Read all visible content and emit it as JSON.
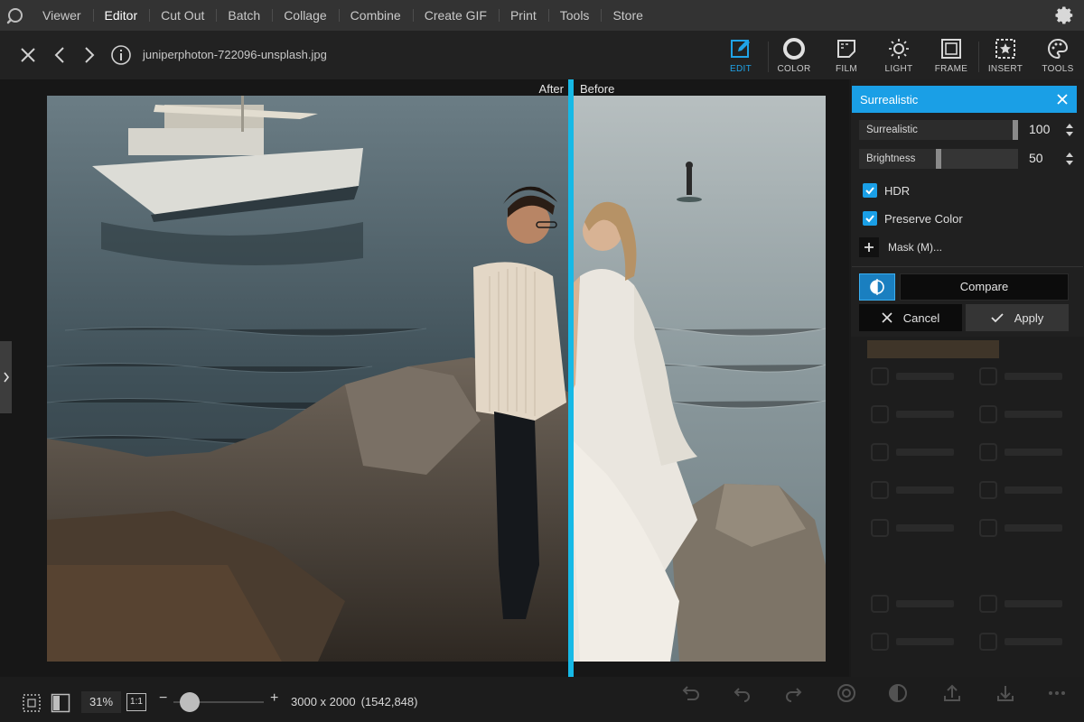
{
  "menu": {
    "items": [
      {
        "label": "Viewer"
      },
      {
        "label": "Editor"
      },
      {
        "label": "Cut Out"
      },
      {
        "label": "Batch"
      },
      {
        "label": "Collage"
      },
      {
        "label": "Combine"
      },
      {
        "label": "Create GIF"
      },
      {
        "label": "Print"
      },
      {
        "label": "Tools"
      },
      {
        "label": "Store"
      }
    ],
    "active": "Editor"
  },
  "toolbar": {
    "filename": "juniperphoton-722096-unsplash.jpg",
    "tabs": [
      {
        "label": "EDIT",
        "icon": "edit-icon"
      },
      {
        "label": "COLOR",
        "icon": "color-icon"
      },
      {
        "label": "FILM",
        "icon": "film-icon"
      },
      {
        "label": "LIGHT",
        "icon": "light-icon"
      },
      {
        "label": "FRAME",
        "icon": "frame-icon"
      },
      {
        "label": "INSERT",
        "icon": "insert-icon"
      },
      {
        "label": "TOOLS",
        "icon": "tools-icon"
      }
    ],
    "active_tab": "EDIT"
  },
  "canvas": {
    "after_label": "After",
    "before_label": "Before",
    "split_fraction": 0.67
  },
  "panel": {
    "title": "Surrealistic",
    "sliders": [
      {
        "label": "Surrealistic",
        "value": "100",
        "fraction": 1.0
      },
      {
        "label": "Brightness",
        "value": "50",
        "fraction": 0.5
      }
    ],
    "checkboxes": [
      {
        "label": "HDR",
        "checked": true
      },
      {
        "label": "Preserve Color",
        "checked": true
      }
    ],
    "mask_label": "Mask (M)...",
    "compare_label": "Compare",
    "cancel_label": "Cancel",
    "apply_label": "Apply"
  },
  "status": {
    "zoom": "31%",
    "fit_label": "1:1",
    "zoom_fraction": 0.18,
    "dimensions": "3000 x 2000",
    "position": "(1542,848)"
  },
  "colors": {
    "accent": "#1a9fe6",
    "split_line": "#16b9e6",
    "menubar": "#333333"
  }
}
